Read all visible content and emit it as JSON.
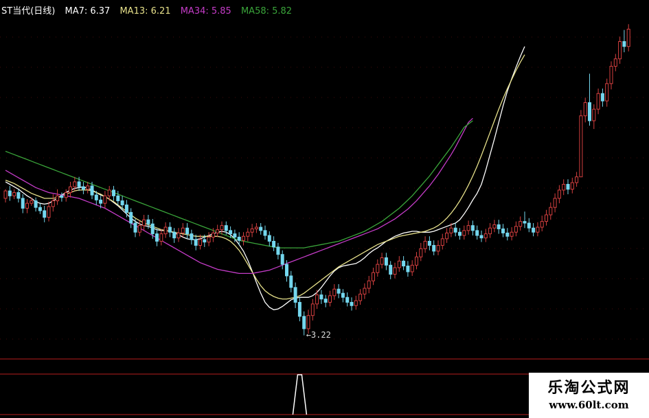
{
  "colors": {
    "background": "#000000",
    "up": "#d64040",
    "down": "#74d7ee",
    "ma7": "#ffffff",
    "ma13": "#e6e08a",
    "ma34": "#c53cc8",
    "ma58": "#3aa53a",
    "separator": "#7a1414",
    "grid": "#7a1414",
    "indicator": "#ffffff"
  },
  "legend": {
    "title": "ST当代(日线)",
    "ma7": "MA7: 6.37",
    "ma13": "MA13: 6.21",
    "ma34": "MA34: 5.85",
    "ma58": "MA58: 5.82"
  },
  "low_marker": "←3.22",
  "watermark": {
    "cn": "乐淘公式网",
    "url": "www.60lt.com"
  },
  "chart_data": {
    "type": "candlestick",
    "title": "ST当代(日线)",
    "ylim": [
      3.0,
      7.2
    ],
    "grid": true,
    "candles": [
      [
        4.88,
        4.97,
        4.99,
        4.83
      ],
      [
        4.97,
        4.91,
        5.03,
        4.85
      ],
      [
        4.91,
        4.95,
        4.99,
        4.87
      ],
      [
        4.95,
        4.88,
        4.99,
        4.83
      ],
      [
        4.88,
        4.76,
        4.93,
        4.7
      ],
      [
        4.76,
        4.82,
        4.87,
        4.7
      ],
      [
        4.82,
        4.85,
        4.89,
        4.79
      ],
      [
        4.85,
        4.77,
        4.89,
        4.72
      ],
      [
        4.77,
        4.73,
        4.82,
        4.69
      ],
      [
        4.73,
        4.65,
        4.79,
        4.59
      ],
      [
        4.65,
        4.78,
        4.84,
        4.6
      ],
      [
        4.78,
        4.85,
        4.93,
        4.72
      ],
      [
        4.85,
        4.91,
        4.99,
        4.8
      ],
      [
        4.91,
        4.89,
        4.95,
        4.84
      ],
      [
        4.89,
        4.95,
        4.99,
        4.84
      ],
      [
        4.95,
        5.02,
        5.08,
        4.89
      ],
      [
        5.02,
        5.08,
        5.14,
        4.97
      ],
      [
        5.08,
        5.02,
        5.14,
        4.97
      ],
      [
        5.02,
        4.99,
        5.08,
        4.93
      ],
      [
        4.99,
        5.03,
        5.08,
        4.94
      ],
      [
        5.03,
        4.92,
        5.08,
        4.87
      ],
      [
        4.92,
        4.86,
        4.97,
        4.8
      ],
      [
        4.86,
        4.82,
        4.91,
        4.76
      ],
      [
        4.82,
        4.91,
        4.97,
        4.76
      ],
      [
        4.91,
        4.98,
        5.03,
        4.85
      ],
      [
        4.98,
        4.91,
        5.03,
        4.85
      ],
      [
        4.91,
        4.85,
        4.97,
        4.8
      ],
      [
        4.85,
        4.8,
        4.91,
        4.74
      ],
      [
        4.8,
        4.71,
        4.86,
        4.65
      ],
      [
        4.71,
        4.58,
        4.76,
        4.52
      ],
      [
        4.58,
        4.47,
        4.63,
        4.41
      ],
      [
        4.47,
        4.55,
        4.61,
        4.42
      ],
      [
        4.55,
        4.62,
        4.68,
        4.49
      ],
      [
        4.62,
        4.57,
        4.68,
        4.51
      ],
      [
        4.57,
        4.45,
        4.63,
        4.39
      ],
      [
        4.45,
        4.36,
        4.51,
        4.3
      ],
      [
        4.36,
        4.45,
        4.51,
        4.31
      ],
      [
        4.45,
        4.53,
        4.59,
        4.4
      ],
      [
        4.53,
        4.47,
        4.59,
        4.41
      ],
      [
        4.47,
        4.4,
        4.52,
        4.34
      ],
      [
        4.4,
        4.46,
        4.52,
        4.35
      ],
      [
        4.46,
        4.52,
        4.58,
        4.41
      ],
      [
        4.52,
        4.45,
        4.58,
        4.39
      ],
      [
        4.45,
        4.38,
        4.5,
        4.32
      ],
      [
        4.38,
        4.31,
        4.44,
        4.25
      ],
      [
        4.31,
        4.38,
        4.44,
        4.26
      ],
      [
        4.38,
        4.35,
        4.44,
        4.29
      ],
      [
        4.35,
        4.41,
        4.47,
        4.3
      ],
      [
        4.41,
        4.46,
        4.52,
        4.35
      ],
      [
        4.46,
        4.5,
        4.56,
        4.41
      ],
      [
        4.5,
        4.55,
        4.6,
        4.44
      ],
      [
        4.55,
        4.49,
        4.6,
        4.44
      ],
      [
        4.49,
        4.45,
        4.54,
        4.4
      ],
      [
        4.45,
        4.41,
        4.5,
        4.35
      ],
      [
        4.41,
        4.37,
        4.47,
        4.31
      ],
      [
        4.37,
        4.42,
        4.47,
        4.31
      ],
      [
        4.42,
        4.47,
        4.52,
        4.36
      ],
      [
        4.47,
        4.51,
        4.57,
        4.41
      ],
      [
        4.51,
        4.53,
        4.58,
        4.46
      ],
      [
        4.53,
        4.49,
        4.58,
        4.44
      ],
      [
        4.49,
        4.43,
        4.55,
        4.38
      ],
      [
        4.43,
        4.36,
        4.48,
        4.3
      ],
      [
        4.36,
        4.29,
        4.42,
        4.24
      ],
      [
        4.29,
        4.2,
        4.34,
        4.14
      ],
      [
        4.2,
        4.08,
        4.25,
        4.02
      ],
      [
        4.08,
        3.94,
        4.13,
        3.87
      ],
      [
        3.94,
        3.8,
        4.0,
        3.74
      ],
      [
        3.8,
        3.62,
        3.86,
        3.55
      ],
      [
        3.62,
        3.45,
        3.68,
        3.39
      ],
      [
        3.45,
        3.3,
        3.51,
        3.22
      ],
      [
        3.3,
        3.46,
        3.53,
        3.24
      ],
      [
        3.46,
        3.6,
        3.66,
        3.4
      ],
      [
        3.6,
        3.71,
        3.77,
        3.54
      ],
      [
        3.71,
        3.66,
        3.77,
        3.6
      ],
      [
        3.66,
        3.62,
        3.71,
        3.56
      ],
      [
        3.62,
        3.7,
        3.76,
        3.57
      ],
      [
        3.7,
        3.78,
        3.84,
        3.65
      ],
      [
        3.78,
        3.73,
        3.84,
        3.67
      ],
      [
        3.73,
        3.68,
        3.78,
        3.62
      ],
      [
        3.68,
        3.62,
        3.74,
        3.57
      ],
      [
        3.62,
        3.58,
        3.68,
        3.52
      ],
      [
        3.58,
        3.64,
        3.7,
        3.53
      ],
      [
        3.64,
        3.72,
        3.78,
        3.59
      ],
      [
        3.72,
        3.79,
        3.85,
        3.66
      ],
      [
        3.79,
        3.88,
        3.94,
        3.73
      ],
      [
        3.88,
        3.98,
        4.04,
        3.83
      ],
      [
        3.98,
        4.08,
        4.14,
        3.93
      ],
      [
        4.08,
        4.16,
        4.22,
        4.03
      ],
      [
        4.16,
        4.07,
        4.22,
        4.01
      ],
      [
        4.07,
        3.96,
        4.12,
        3.9
      ],
      [
        3.96,
        4.04,
        4.1,
        3.91
      ],
      [
        4.04,
        4.12,
        4.18,
        3.99
      ],
      [
        4.12,
        4.06,
        4.18,
        4.01
      ],
      [
        4.06,
        3.99,
        4.12,
        3.93
      ],
      [
        3.99,
        4.07,
        4.13,
        3.94
      ],
      [
        4.07,
        4.17,
        4.23,
        4.02
      ],
      [
        4.17,
        4.27,
        4.34,
        4.12
      ],
      [
        4.27,
        4.36,
        4.42,
        4.22
      ],
      [
        4.36,
        4.31,
        4.42,
        4.25
      ],
      [
        4.31,
        4.24,
        4.37,
        4.19
      ],
      [
        4.24,
        4.31,
        4.37,
        4.19
      ],
      [
        4.31,
        4.39,
        4.45,
        4.26
      ],
      [
        4.39,
        4.46,
        4.52,
        4.34
      ],
      [
        4.46,
        4.52,
        4.58,
        4.41
      ],
      [
        4.52,
        4.47,
        4.58,
        4.42
      ],
      [
        4.47,
        4.43,
        4.52,
        4.38
      ],
      [
        4.43,
        4.49,
        4.55,
        4.38
      ],
      [
        4.49,
        4.55,
        4.61,
        4.44
      ],
      [
        4.55,
        4.49,
        4.61,
        4.43
      ],
      [
        4.49,
        4.43,
        4.55,
        4.38
      ],
      [
        4.43,
        4.4,
        4.49,
        4.35
      ],
      [
        4.4,
        4.45,
        4.51,
        4.35
      ],
      [
        4.45,
        4.52,
        4.58,
        4.4
      ],
      [
        4.52,
        4.56,
        4.62,
        4.47
      ],
      [
        4.56,
        4.51,
        4.62,
        4.45
      ],
      [
        4.51,
        4.46,
        4.57,
        4.41
      ],
      [
        4.46,
        4.42,
        4.52,
        4.37
      ],
      [
        4.42,
        4.47,
        4.53,
        4.37
      ],
      [
        4.47,
        4.54,
        4.6,
        4.42
      ],
      [
        4.54,
        4.6,
        4.66,
        4.49
      ],
      [
        4.6,
        4.58,
        4.72,
        4.52
      ],
      [
        4.58,
        4.52,
        4.64,
        4.47
      ],
      [
        4.52,
        4.47,
        4.58,
        4.42
      ],
      [
        4.47,
        4.53,
        4.59,
        4.42
      ],
      [
        4.53,
        4.6,
        4.67,
        4.48
      ],
      [
        4.6,
        4.68,
        4.74,
        4.55
      ],
      [
        4.68,
        4.77,
        4.83,
        4.62
      ],
      [
        4.77,
        4.88,
        4.94,
        4.71
      ],
      [
        4.88,
        4.98,
        5.04,
        4.82
      ],
      [
        4.98,
        5.05,
        5.11,
        4.92
      ],
      [
        5.05,
        4.99,
        5.11,
        4.93
      ],
      [
        4.99,
        5.07,
        5.13,
        4.94
      ],
      [
        5.07,
        5.14,
        5.2,
        5.02
      ],
      [
        5.14,
        5.88,
        5.95,
        5.82
      ],
      [
        5.88,
        6.04,
        6.1,
        5.8
      ],
      [
        6.04,
        5.82,
        6.39,
        5.76
      ],
      [
        5.82,
        5.96,
        6.02,
        5.72
      ],
      [
        5.96,
        6.15,
        6.21,
        5.9
      ],
      [
        6.15,
        6.06,
        6.21,
        5.99
      ],
      [
        6.06,
        6.27,
        6.33,
        5.99
      ],
      [
        6.27,
        6.48,
        6.54,
        6.2
      ],
      [
        6.48,
        6.57,
        6.63,
        6.42
      ],
      [
        6.57,
        6.78,
        6.84,
        6.51
      ],
      [
        6.78,
        6.72,
        6.92,
        6.65
      ],
      [
        6.72,
        6.93,
        6.99,
        6.66
      ]
    ],
    "ma_series": [
      {
        "name": "MA7",
        "color": "#ffffff",
        "start_index": 0,
        "values": [
          5.08,
          5.05,
          5.02,
          4.99,
          4.95,
          4.91,
          4.88,
          4.84,
          4.82,
          4.81,
          4.82,
          4.85,
          4.88,
          4.92,
          4.95,
          4.98,
          5.0,
          5.01,
          5.02,
          5.0,
          4.98,
          4.95,
          4.92,
          4.9,
          4.87,
          4.83,
          4.79,
          4.74,
          4.69,
          4.64,
          4.6,
          4.57,
          4.55,
          4.54,
          4.52,
          4.5,
          4.49,
          4.49,
          4.48,
          4.46,
          4.44,
          4.41,
          4.39,
          4.38,
          4.38,
          4.39,
          4.41,
          4.43,
          4.45,
          4.47,
          4.48,
          4.47,
          4.44,
          4.39,
          4.32,
          4.24,
          4.13,
          4.0,
          3.86,
          3.73,
          3.62,
          3.56,
          3.53,
          3.54,
          3.57,
          3.61,
          3.65,
          3.67,
          3.68,
          3.68,
          3.68,
          3.7,
          3.74,
          3.8,
          3.87,
          3.94,
          4.0,
          4.04,
          4.06,
          4.07,
          4.08,
          4.09,
          4.12,
          4.16,
          4.21,
          4.25,
          4.28,
          4.32,
          4.36,
          4.39,
          4.42,
          4.44,
          4.46,
          4.47,
          4.48,
          4.48,
          4.47,
          4.47,
          4.47,
          4.48,
          4.5,
          4.52,
          4.54,
          4.56,
          4.58,
          4.62,
          4.69,
          4.77,
          4.86,
          4.94,
          5.05,
          5.22,
          5.41,
          5.6,
          5.8,
          6.0,
          6.18,
          6.33,
          6.47,
          6.6,
          6.72
        ]
      },
      {
        "name": "MA13",
        "color": "#e6e08a",
        "start_index": 0,
        "values": [
          5.1,
          5.08,
          5.06,
          5.03,
          5.0,
          4.97,
          4.94,
          4.92,
          4.9,
          4.88,
          4.88,
          4.88,
          4.89,
          4.91,
          4.93,
          4.95,
          4.97,
          4.98,
          4.98,
          4.98,
          4.97,
          4.95,
          4.93,
          4.9,
          4.87,
          4.84,
          4.8,
          4.76,
          4.72,
          4.68,
          4.64,
          4.61,
          4.58,
          4.56,
          4.54,
          4.52,
          4.5,
          4.49,
          4.48,
          4.47,
          4.46,
          4.45,
          4.44,
          4.43,
          4.42,
          4.42,
          4.42,
          4.42,
          4.42,
          4.42,
          4.41,
          4.39,
          4.36,
          4.31,
          4.25,
          4.17,
          4.08,
          3.99,
          3.9,
          3.82,
          3.76,
          3.72,
          3.69,
          3.67,
          3.66,
          3.66,
          3.67,
          3.68,
          3.7,
          3.73,
          3.77,
          3.81,
          3.85,
          3.89,
          3.93,
          3.97,
          4.01,
          4.05,
          4.08,
          4.11,
          4.14,
          4.17,
          4.2,
          4.23,
          4.26,
          4.29,
          4.32,
          4.34,
          4.36,
          4.38,
          4.4,
          4.42,
          4.43,
          4.44,
          4.45,
          4.46,
          4.47,
          4.48,
          4.5,
          4.52,
          4.55,
          4.59,
          4.64,
          4.7,
          4.77,
          4.85,
          4.94,
          5.04,
          5.15,
          5.27,
          5.4,
          5.54,
          5.68,
          5.82,
          5.96,
          6.09,
          6.21,
          6.32,
          6.43,
          6.53,
          6.62
        ]
      },
      {
        "name": "MA34",
        "color": "#c53cc8",
        "start_index": 0,
        "values": [
          5.22,
          5.19,
          5.16,
          5.13,
          5.1,
          5.07,
          5.04,
          5.01,
          4.99,
          4.97,
          4.95,
          4.94,
          4.93,
          4.92,
          4.91,
          4.9,
          4.89,
          4.88,
          4.86,
          4.84,
          4.82,
          4.8,
          4.78,
          4.76,
          4.73,
          4.7,
          4.67,
          4.64,
          4.61,
          4.58,
          4.55,
          4.52,
          4.49,
          4.46,
          4.43,
          4.4,
          4.37,
          4.34,
          4.31,
          4.28,
          4.25,
          4.22,
          4.19,
          4.16,
          4.13,
          4.1,
          4.08,
          4.06,
          4.04,
          4.02,
          4.01,
          4.0,
          3.99,
          3.98,
          3.97,
          3.97,
          3.97,
          3.97,
          3.98,
          3.99,
          4.0,
          4.01,
          4.03,
          4.05,
          4.07,
          4.09,
          4.11,
          4.13,
          4.15,
          4.17,
          4.19,
          4.21,
          4.23,
          4.25,
          4.27,
          4.29,
          4.31,
          4.33,
          4.35,
          4.37,
          4.39,
          4.41,
          4.43,
          4.45,
          4.47,
          4.49,
          4.51,
          4.54,
          4.57,
          4.6,
          4.63,
          4.67,
          4.71,
          4.75,
          4.8,
          4.85,
          4.91,
          4.97,
          5.03,
          5.1,
          5.17,
          5.25,
          5.33,
          5.41,
          5.5,
          5.6,
          5.7,
          5.8,
          5.85
        ]
      },
      {
        "name": "MA58",
        "color": "#3aa53a",
        "start_index": 0,
        "values": [
          5.45,
          5.43,
          5.41,
          5.39,
          5.37,
          5.35,
          5.33,
          5.31,
          5.29,
          5.27,
          5.25,
          5.23,
          5.21,
          5.19,
          5.17,
          5.15,
          5.13,
          5.11,
          5.09,
          5.07,
          5.05,
          5.03,
          5.01,
          4.99,
          4.97,
          4.95,
          4.93,
          4.91,
          4.89,
          4.87,
          4.85,
          4.83,
          4.81,
          4.79,
          4.77,
          4.75,
          4.73,
          4.71,
          4.69,
          4.67,
          4.65,
          4.63,
          4.61,
          4.59,
          4.57,
          4.55,
          4.53,
          4.51,
          4.49,
          4.47,
          4.45,
          4.43,
          4.41,
          4.39,
          4.37,
          4.36,
          4.35,
          4.34,
          4.33,
          4.32,
          4.31,
          4.3,
          4.29,
          4.28,
          4.28,
          4.28,
          4.28,
          4.28,
          4.28,
          4.28,
          4.29,
          4.3,
          4.31,
          4.32,
          4.33,
          4.34,
          4.35,
          4.36,
          4.38,
          4.4,
          4.42,
          4.44,
          4.46,
          4.48,
          4.51,
          4.54,
          4.57,
          4.6,
          4.64,
          4.68,
          4.72,
          4.76,
          4.81,
          4.86,
          4.91,
          4.97,
          5.03,
          5.09,
          5.15,
          5.22,
          5.29,
          5.36,
          5.43,
          5.5,
          5.58,
          5.66,
          5.74,
          5.78,
          5.82
        ]
      }
    ],
    "low": {
      "index": 69,
      "value": 3.22
    },
    "indicator": {
      "type": "spike",
      "index": 68
    }
  }
}
